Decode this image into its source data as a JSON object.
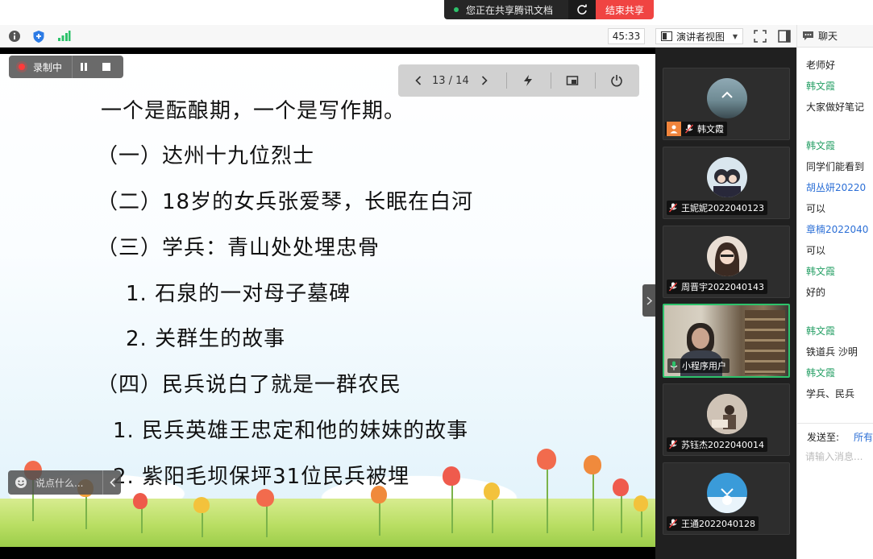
{
  "share_bar": {
    "status_text": "您正在共享腾讯文档",
    "stop_label": "结束共享"
  },
  "toolbar": {
    "timer": "45:33",
    "view_mode": "演讲者视图",
    "chat_label": "聊天"
  },
  "recording": {
    "label": "录制中"
  },
  "pager": {
    "page_text": "13 / 14"
  },
  "chat_input_overlay": {
    "placeholder": "说点什么..."
  },
  "slide": {
    "lines": [
      "一个是酝酿期，一个是写作期。",
      "（一）达州十九位烈士",
      "（二）18岁的女兵张爱琴，长眠在白河",
      "（三）学兵：青山处处埋忠骨",
      "1. 石泉的一对母子墓碑",
      "2. 关群生的故事",
      "（四）民兵说白了就是一群农民",
      "1. 民兵英雄王忠定和他的妹妹的故事",
      "2. 紫阳毛坝保坪31位民兵被埋"
    ]
  },
  "participants": [
    {
      "name": "韩文霞"
    },
    {
      "name": "王妮妮2022040123"
    },
    {
      "name": "周晋宇2022040143"
    },
    {
      "name": "小程序用户"
    },
    {
      "name": "苏钰杰2022040014"
    },
    {
      "name": "王通2022040128"
    }
  ],
  "chat": {
    "messages": [
      {
        "kind": "text",
        "text": "老师好"
      },
      {
        "kind": "sender",
        "text": "韩文霞"
      },
      {
        "kind": "text",
        "text": "大家做好笔记"
      },
      {
        "kind": "sender",
        "text": "韩文霞"
      },
      {
        "kind": "text",
        "text": "同学们能看到"
      },
      {
        "kind": "sender-blue",
        "text": "胡丛妍20220"
      },
      {
        "kind": "text",
        "text": "可以"
      },
      {
        "kind": "sender-blue",
        "text": "章楠2022040"
      },
      {
        "kind": "text",
        "text": "可以"
      },
      {
        "kind": "sender",
        "text": "韩文霞"
      },
      {
        "kind": "text",
        "text": "好的"
      },
      {
        "kind": "sender",
        "text": "韩文霞"
      },
      {
        "kind": "text",
        "text": "铁道兵 沙明"
      },
      {
        "kind": "sender",
        "text": "韩文霞"
      },
      {
        "kind": "text",
        "text": "学兵、民兵"
      }
    ],
    "send_to_label": "发送至:",
    "send_to_value": "所有",
    "input_placeholder": "请输入消息..."
  },
  "colors": {
    "accent_green": "#2dc26b",
    "stop_red": "#f04442",
    "sender_green": "#2aa168",
    "sender_blue": "#2c6fd6"
  }
}
